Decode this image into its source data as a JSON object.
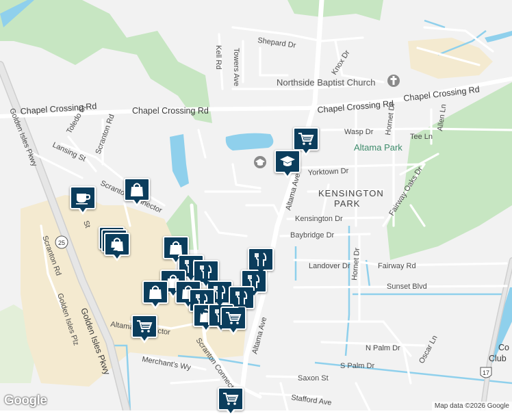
{
  "roads": {
    "shepard_dr": "Shepard Dr",
    "kell_rd": "Kell Rd",
    "towers_ave": "Towers Ave",
    "knox_dr": "Knox Dr",
    "chapel_crossing_rd": "Chapel Crossing Rd",
    "toledo_st": "Toledo St",
    "scranton_rd": "Scranton Rd",
    "lansing_st": "Lansing St",
    "golden_isles_pkwy": "Golden Isles Pkwy",
    "wasp_dr": "Wasp Dr",
    "hornet_dr": "Hornet Dr",
    "tee_ln": "Tee Ln",
    "allen_ln": "Allen Ln",
    "yorktown_dr": "Yorktown Dr",
    "fairway_oaks_dr": "Fairway Oaks Dr",
    "altama_ave": "Altama Ave",
    "kensington_dr": "Kensington Dr",
    "baybridge_dr": "Baybridge Dr",
    "landover_dr": "Landover Dr",
    "fairway_rd": "Fairway Rd",
    "sunset_blvd": "Sunset Blvd",
    "scranton_connector": "Scranton Connector",
    "altama_connector": "Altama Connector",
    "merchants_wy": "Merchant's Wy",
    "golden_isles_plz": "Golden Isles Plz",
    "n_palm_dr": "N Palm Dr",
    "s_palm_dr": "S Palm Dr",
    "oscar_ln": "Oscar Ln",
    "saxon_st": "Saxon St",
    "stafford_ave": "Stafford Ave",
    "route_25": "25",
    "route_17": "17",
    "scranton_connector_short": "Scranton Connector",
    "altama_connector_short": "Altama Connector",
    "st_fragment": "St"
  },
  "places": {
    "northside_baptist_church": "Northside Baptist Church",
    "altama_park": "Altama Park",
    "kensington": "KENSINGTON",
    "park": "PARK",
    "country_club_1": "Co",
    "country_club_2": "Club"
  },
  "icons": {
    "grocery": "shopping-cart-icon",
    "school": "graduation-cap-icon",
    "cafe": "coffee-cup-icon",
    "shopping": "shopping-bag-icon",
    "restaurant": "fork-knife-icon",
    "church": "cross-icon"
  },
  "attribution": {
    "logo": "Google",
    "map_data": "Map data ©2026 Google"
  },
  "colors": {
    "marker": "#0b3d5c",
    "park": "#b8e0b4",
    "water": "#8fd0ec",
    "commercial": "#f5ecd4",
    "road": "#ffffff",
    "highway": "#e3e3e3"
  }
}
